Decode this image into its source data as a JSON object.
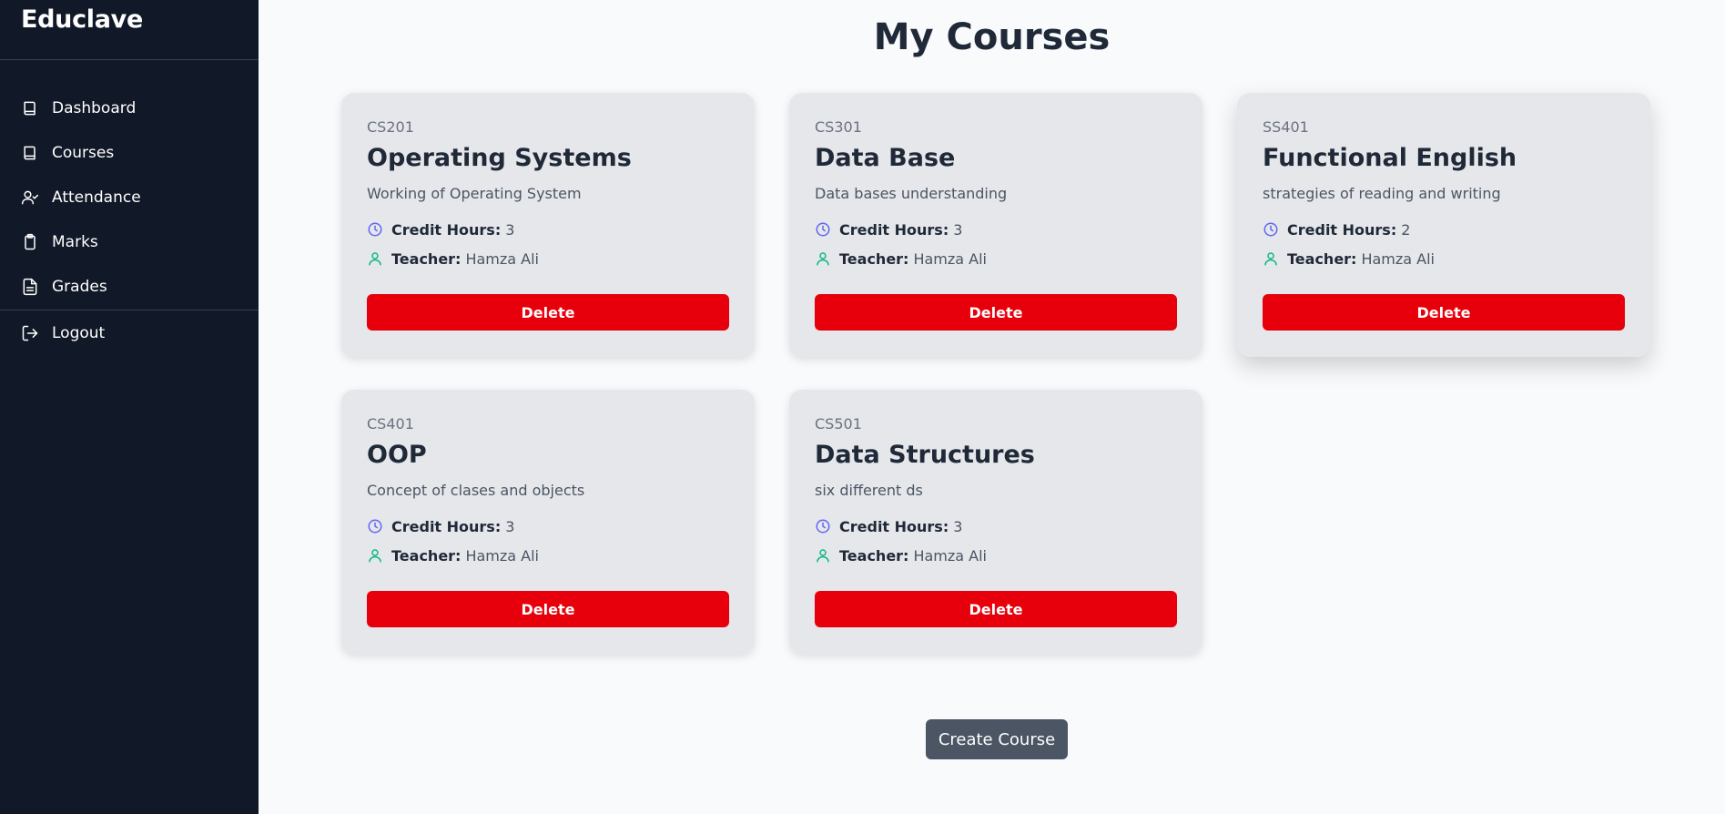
{
  "app": {
    "brand": "Educlave"
  },
  "sidebar": {
    "items": [
      {
        "label": "Dashboard",
        "icon": "book-icon"
      },
      {
        "label": "Courses",
        "icon": "book-icon"
      },
      {
        "label": "Attendance",
        "icon": "user-check-icon"
      },
      {
        "label": "Marks",
        "icon": "clipboard-icon"
      },
      {
        "label": "Grades",
        "icon": "document-icon"
      }
    ],
    "logout": {
      "label": "Logout",
      "icon": "logout-icon"
    }
  },
  "page": {
    "title": "My Courses"
  },
  "labels": {
    "credit_hours": "Credit Hours:",
    "teacher": "Teacher:",
    "delete": "Delete"
  },
  "courses": [
    {
      "code": "CS201",
      "title": "Operating Systems",
      "description": "Working of Operating System",
      "credit_hours": "3",
      "teacher": "Hamza Ali"
    },
    {
      "code": "CS301",
      "title": "Data Base",
      "description": "Data bases understanding",
      "credit_hours": "3",
      "teacher": "Hamza Ali"
    },
    {
      "code": "SS401",
      "title": "Functional English",
      "description": "strategies of reading and writing",
      "credit_hours": "2",
      "teacher": "Hamza Ali"
    },
    {
      "code": "CS401",
      "title": "OOP",
      "description": "Concept of clases and objects",
      "credit_hours": "3",
      "teacher": "Hamza Ali"
    },
    {
      "code": "CS501",
      "title": "Data Structures",
      "description": "six different ds",
      "credit_hours": "3",
      "teacher": "Hamza Ali"
    }
  ],
  "actions": {
    "create_course": "Create Course"
  },
  "colors": {
    "sidebar_bg": "#111827",
    "delete_button": "#e7000b",
    "create_button": "#4b5563",
    "clock_icon": "#6366f1",
    "teacher_icon": "#10b981"
  }
}
